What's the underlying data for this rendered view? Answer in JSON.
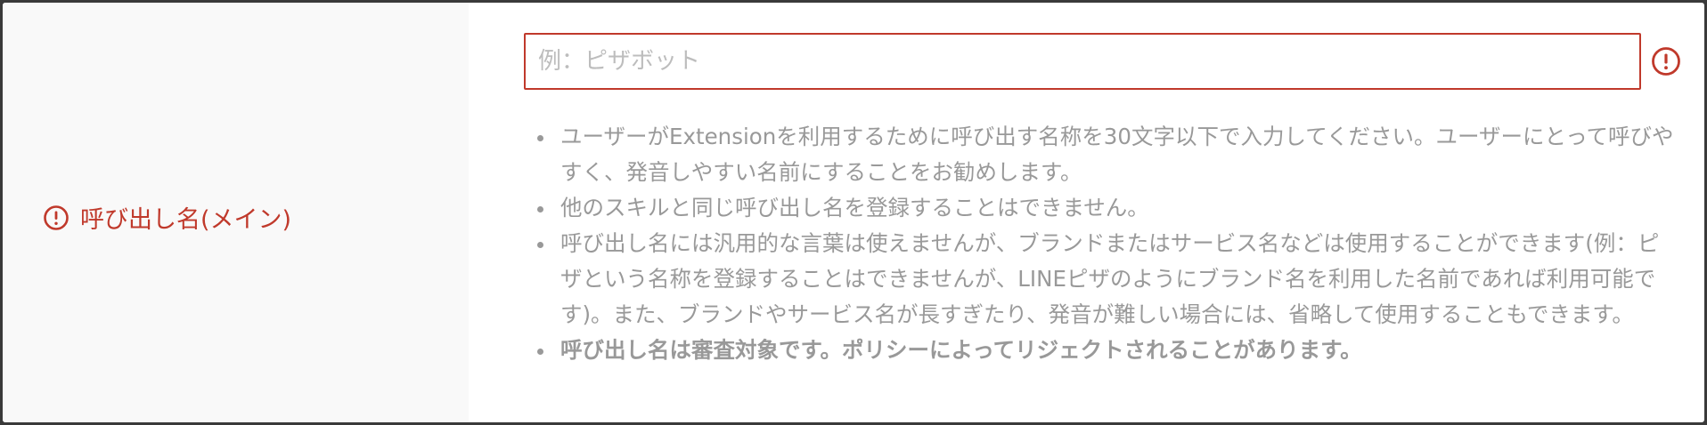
{
  "field": {
    "label": "呼び出し名(メイン)",
    "label_icon": "alert-circle-icon",
    "input_placeholder": "例：ピザボット",
    "input_value": "",
    "input_error_icon": "alert-circle-icon"
  },
  "notes": [
    "ユーザーがExtensionを利用するために呼び出す名称を30文字以下で入力してください。ユーザーにとって呼びやすく、発音しやすい名前にすることをお勧めします。",
    "他のスキルと同じ呼び出し名を登録することはできません。",
    "呼び出し名には汎用的な言葉は使えませんが、ブランドまたはサービス名などは使用することができます(例：ピザという名称を登録することはできませんが、LINEピザのようにブランド名を利用した名前であれば利用可能です)。また、ブランドやサービス名が長すぎたり、発音が難しい場合には、省略して使用することもできます。",
    "呼び出し名は審査対象です。ポリシーによってリジェクトされることがあります。"
  ],
  "colors": {
    "error": "#c0392b",
    "hint_text": "#999999",
    "label_bg": "#f9f9f9"
  }
}
